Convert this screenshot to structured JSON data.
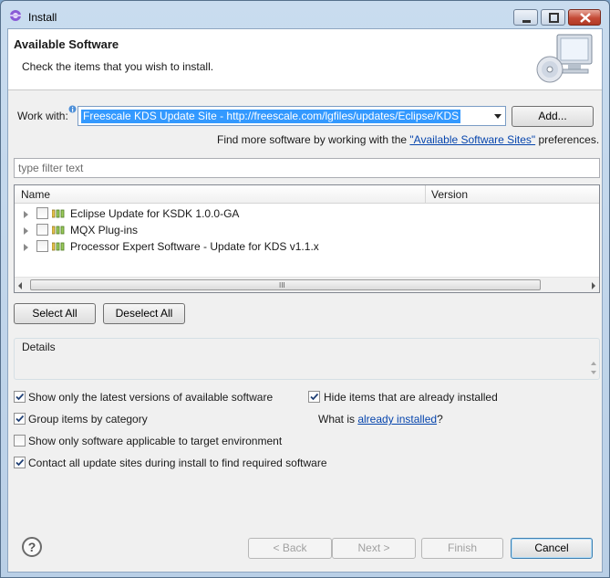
{
  "window": {
    "title": "Install",
    "icon": "eclipse-install-icon",
    "controls": [
      "minimize",
      "maximize",
      "close"
    ]
  },
  "banner": {
    "title": "Available Software",
    "subtitle": "Check the items that you wish to install.",
    "icon": "software-cd-monitor-icon"
  },
  "work_with": {
    "label": "Work with:",
    "value": "Freescale KDS Update Site - http://freescale.com/lgfiles/updates/Eclipse/KDS",
    "add_button": "Add...",
    "info_icon": "info-icon"
  },
  "sites_hint": {
    "prefix": "Find more software by working with the ",
    "link": "\"Available Software Sites\"",
    "suffix": " preferences."
  },
  "filter": {
    "placeholder": "type filter text"
  },
  "tree": {
    "columns": [
      "Name",
      "Version"
    ],
    "rows": [
      {
        "label": "Eclipse Update for KSDK 1.0.0-GA",
        "checked": false
      },
      {
        "label": "MQX Plug-ins",
        "checked": false
      },
      {
        "label": "Processor Expert Software - Update for KDS v1.1.x",
        "checked": false
      }
    ],
    "scroll_grip": "III"
  },
  "selection_buttons": {
    "select_all": "Select All",
    "deselect_all": "Deselect All"
  },
  "details": {
    "title": "Details"
  },
  "options": {
    "show_latest": {
      "label": "Show only the latest versions of available software",
      "checked": true
    },
    "hide_installed": {
      "label": "Hide items that are already installed",
      "checked": true
    },
    "group_by_category": {
      "label": "Group items by category",
      "checked": true
    },
    "what_is_prefix": "What is ",
    "what_is_link": "already installed",
    "what_is_suffix": "?",
    "target_env": {
      "label": "Show only software applicable to target environment",
      "checked": false
    },
    "contact_sites": {
      "label": "Contact all update sites during install to find required software",
      "checked": true
    }
  },
  "footer": {
    "help": "?",
    "back": "< Back",
    "next": "Next >",
    "finish": "Finish",
    "cancel": "Cancel"
  },
  "colors": {
    "selection": "#3399ff",
    "link": "#0645ad",
    "dialog_bg": "#f0f0f0",
    "frame": "#b9cfe6"
  }
}
